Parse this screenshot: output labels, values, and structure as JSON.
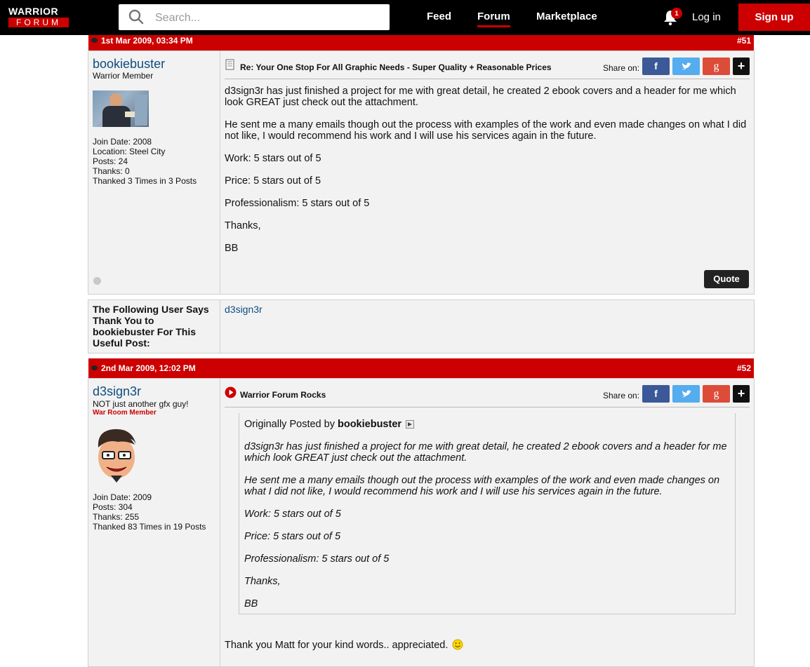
{
  "topbar": {
    "logo_line1": "WARRIOR",
    "logo_line2": "FORUM",
    "search_placeholder": "Search...",
    "nav": [
      "Feed",
      "Forum",
      "Marketplace"
    ],
    "notification_count": "1",
    "login": "Log in",
    "signup": "Sign up"
  },
  "post51": {
    "date": "1st Mar 2009, 03:34 PM",
    "number": "#51",
    "username": "bookiebuster",
    "user_title": "Warrior Member",
    "stats": [
      "Join Date: 2008",
      "Location: Steel City",
      "Posts: 24",
      "Thanks: 0",
      "Thanked 3 Times in 3 Posts"
    ],
    "title": "Re: Your One Stop For All Graphic Needs - Super Quality + Reasonable Prices",
    "share_label": "Share on:",
    "body": [
      "d3sign3r has just finished a project for me with great detail, he created 2 ebook covers and a header for me which look GREAT just check out the attachment.",
      "He sent me a many emails though out the process with examples of the work and even made changes on what I did not like, I would recommend his work and I will use his services again in the future.",
      "Work: 5 stars out of 5",
      "Price: 5 stars out of 5",
      "Professionalism: 5 stars out of 5",
      "Thanks,",
      "BB"
    ],
    "quote_button": "Quote"
  },
  "thanks": {
    "label": "The Following User Says Thank You to bookiebuster For This Useful Post:",
    "users": "d3sign3r"
  },
  "post52": {
    "date": "2nd Mar 2009, 12:02 PM",
    "number": "#52",
    "username": "d3sign3r",
    "user_title": "NOT just another gfx guy!",
    "user_rank": "War Room Member",
    "stats": [
      "Join Date: 2009",
      "Posts: 304",
      "Thanks: 255",
      "Thanked 83 Times in 19 Posts"
    ],
    "title": "Warrior Forum Rocks",
    "share_label": "Share on:",
    "quote_prefix": "Originally Posted by",
    "quote_author": "bookiebuster",
    "quote_body": [
      "d3sign3r has just finished a project for me with great detail, he created 2 ebook covers and a header for me which look GREAT just check out the attachment.",
      "He sent me a many emails though out the process with examples of the work and even made changes on what I did not like, I would recommend his work and I will use his services again in the future.",
      "Work: 5 stars out of 5",
      "Price: 5 stars out of 5",
      "Professionalism: 5 stars out of 5",
      "Thanks,",
      "BB"
    ],
    "reply": "Thank you Matt for your kind words.. appreciated."
  },
  "colors": {
    "brand_red": "#cc0000",
    "facebook": "#3b5998",
    "twitter": "#55acee",
    "google": "#dd4b39",
    "link": "#0f4c81"
  }
}
